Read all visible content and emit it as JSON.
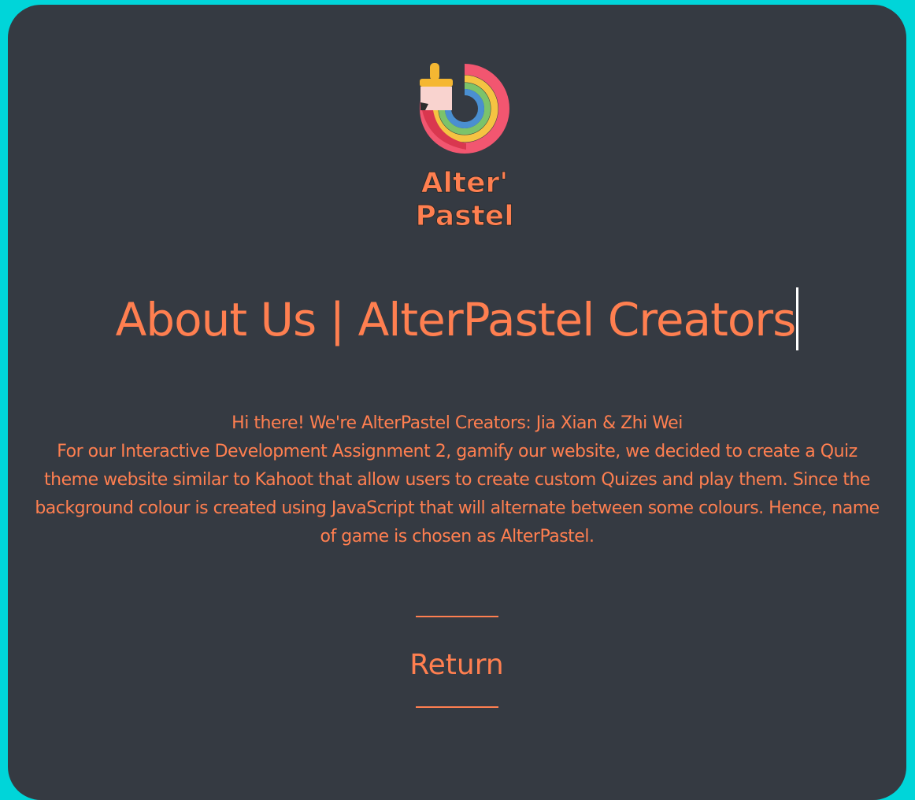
{
  "logo": {
    "line1": "Alter'",
    "line2": "Pastel",
    "icon": "paintbrush-rainbow-icon"
  },
  "title": {
    "text": "About Us | AlterPastel Creators"
  },
  "about": {
    "line1": "Hi there! We're AlterPastel Creators: Jia Xian & Zhi Wei",
    "body": "For our Interactive Development Assignment 2, gamify our website, we decided to create a Quiz theme website similar to Kahoot that allow users to create custom Quizes and play them. Since the background colour is created using JavaScript that will alternate between some colours. Hence, name of game is chosen as AlterPastel."
  },
  "nav": {
    "return_label": "Return"
  },
  "colors": {
    "page_background": "#00d5d9",
    "card_background": "#353a42",
    "accent": "#ff7f50",
    "caret": "#ffffff"
  }
}
